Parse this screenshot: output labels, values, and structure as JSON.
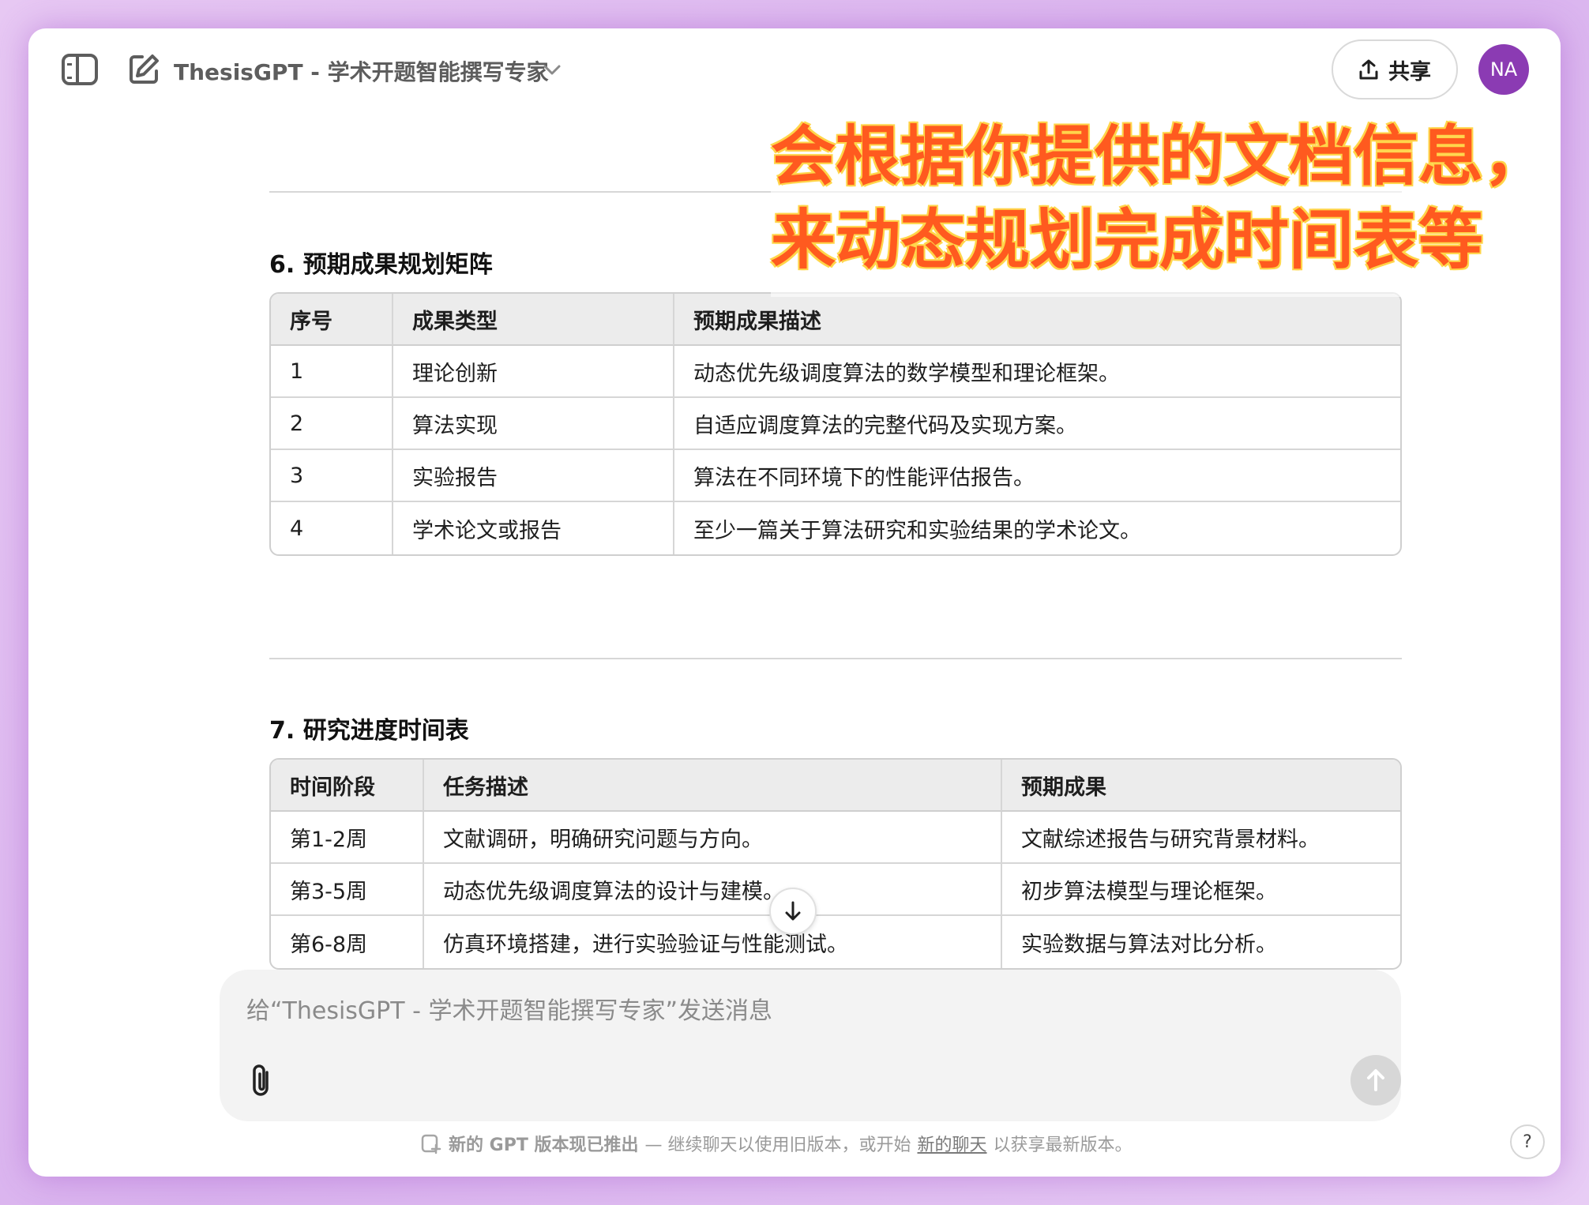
{
  "header": {
    "model_title": "ThesisGPT - 学术开题智能撰写专家",
    "share_label": "共享",
    "avatar_initials": "NA"
  },
  "annotation": {
    "line1": "会根据你提供的文档信息，",
    "line2": "来动态规划完成时间表等"
  },
  "section6": {
    "heading": "6. 预期成果规划矩阵",
    "columns": [
      "序号",
      "成果类型",
      "预期成果描述"
    ],
    "rows": [
      [
        "1",
        "理论创新",
        "动态优先级调度算法的数学模型和理论框架。"
      ],
      [
        "2",
        "算法实现",
        "自适应调度算法的完整代码及实现方案。"
      ],
      [
        "3",
        "实验报告",
        "算法在不同环境下的性能评估报告。"
      ],
      [
        "4",
        "学术论文或报告",
        "至少一篇关于算法研究和实验结果的学术论文。"
      ]
    ]
  },
  "section7": {
    "heading": "7. 研究进度时间表",
    "columns": [
      "时间阶段",
      "任务描述",
      "预期成果"
    ],
    "rows": [
      [
        "第1-2周",
        "文献调研，明确研究问题与方向。",
        "文献综述报告与研究背景材料。"
      ],
      [
        "第3-5周",
        "动态优先级调度算法的设计与建模。",
        "初步算法模型与理论框架。"
      ],
      [
        "第6-8周",
        "仿真环境搭建，进行实验验证与性能测试。",
        "实验数据与算法对比分析。"
      ]
    ]
  },
  "composer": {
    "placeholder": "给“ThesisGPT - 学术开题智能撰写专家”发送消息"
  },
  "footer": {
    "notice_strong": "新的 GPT 版本现已推出",
    "notice_middle": " — 继续聊天以使用旧版本，或开始",
    "notice_link": "新的聊天",
    "notice_end": "以获享最新版本。",
    "help_label": "?"
  },
  "colors": {
    "avatar": "#8b3bb3",
    "annotation_text": "#ff5a1f",
    "annotation_outline": "#ffd54a"
  }
}
